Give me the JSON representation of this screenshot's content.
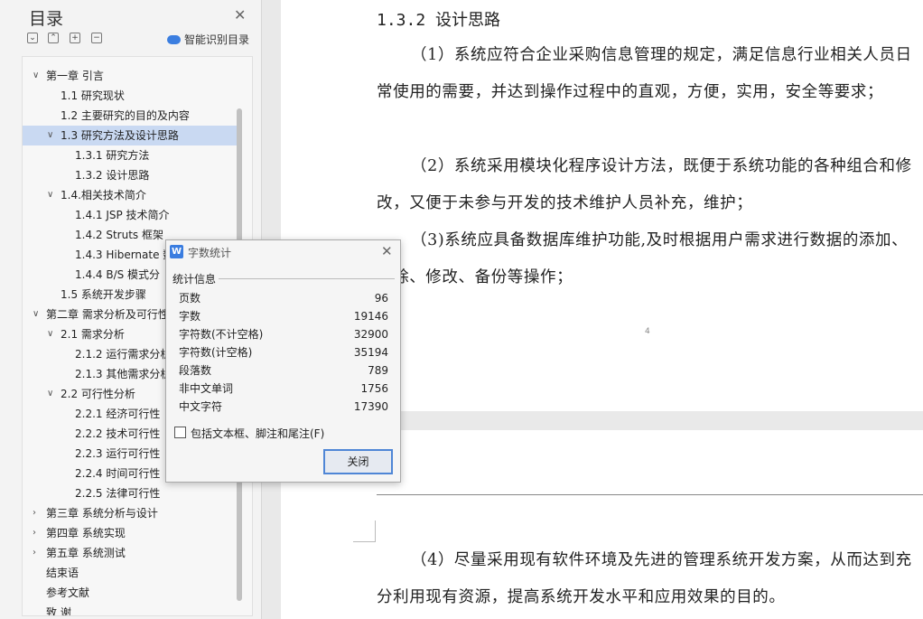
{
  "toc": {
    "title": "目录",
    "smart_toc_label": "智能识别目录",
    "items": [
      {
        "label": "第一章   引言",
        "level": 0,
        "expanded": true
      },
      {
        "label": "1.1 研究现状",
        "level": 1
      },
      {
        "label": "1.2 主要研究的目的及内容",
        "level": 1
      },
      {
        "label": "1.3 研究方法及设计思路",
        "level": 1,
        "expanded": true,
        "selected": true
      },
      {
        "label": "1.3.1  研究方法",
        "level": 2
      },
      {
        "label": "1.3.2  设计思路",
        "level": 2
      },
      {
        "label": "1.4.相关技术简介",
        "level": 1,
        "expanded": true
      },
      {
        "label": "1.4.1 JSP 技术简介",
        "level": 2
      },
      {
        "label": "1.4.2 Struts  框架",
        "level": 2
      },
      {
        "label": "1.4.3 Hibernate 数",
        "level": 2
      },
      {
        "label": "1.4.4    B/S 模式分",
        "level": 2
      },
      {
        "label": "1.5  系统开发步骤",
        "level": 1
      },
      {
        "label": "第二章  需求分析及可行性",
        "level": 0,
        "expanded": true
      },
      {
        "label": "2.1 需求分析",
        "level": 1,
        "expanded": true
      },
      {
        "label": "2.1.2 运行需求分析",
        "level": 2
      },
      {
        "label": "2.1.3 其他需求分析",
        "level": 2
      },
      {
        "label": "2.2  可行性分析",
        "level": 1,
        "expanded": true
      },
      {
        "label": "2.2.1 经济可行性",
        "level": 2
      },
      {
        "label": "2.2.2 技术可行性",
        "level": 2
      },
      {
        "label": "2.2.3  运行可行性",
        "level": 2
      },
      {
        "label": "2.2.4 时间可行性",
        "level": 2
      },
      {
        "label": "2.2.5  法律可行性",
        "level": 2
      },
      {
        "label": "第三章  系统分析与设计",
        "level": 0,
        "expanded": false
      },
      {
        "label": "第四章  系统实现",
        "level": 0,
        "expanded": false
      },
      {
        "label": "第五章    系统测试",
        "level": 0,
        "expanded": false
      },
      {
        "label": "结束语",
        "level": 0
      },
      {
        "label": "参考文献",
        "level": 0
      },
      {
        "label": "致    谢",
        "level": 0
      }
    ]
  },
  "document": {
    "heading": "1.3.2  设计思路",
    "para1": "（1）系统应符合企业采购信息管理的规定，满足信息行业相关人员日常使用的需要，并达到操作过程中的直观，方便，实用，安全等要求；",
    "para2": "（2）系统采用模块化程序设计方法，既便于系统功能的各种组合和修改，又便于未参与开发的技术维护人员补充，维护；",
    "para3": "（3)系统应具备数据库维护功能,及时根据用户需求进行数据的添加、删除、修改、备份等操作；",
    "page_number": "4",
    "para4": "（4）尽量采用现有软件环境及先进的管理系统开发方案，从而达到充分利用现有资源，提高系统开发水平和应用效果的目的。"
  },
  "word_count_dialog": {
    "title": "字数统计",
    "section_label": "统计信息",
    "stats": [
      {
        "label": "页数",
        "value": "96"
      },
      {
        "label": "字数",
        "value": "19146"
      },
      {
        "label": "字符数(不计空格)",
        "value": "32900"
      },
      {
        "label": "字符数(计空格)",
        "value": "35194"
      },
      {
        "label": "段落数",
        "value": "789"
      },
      {
        "label": "非中文单词",
        "value": "1756"
      },
      {
        "label": "中文字符",
        "value": "17390"
      }
    ],
    "include_label": "包括文本框、脚注和尾注(F)",
    "include_checked": false,
    "close_label": "关闭"
  }
}
